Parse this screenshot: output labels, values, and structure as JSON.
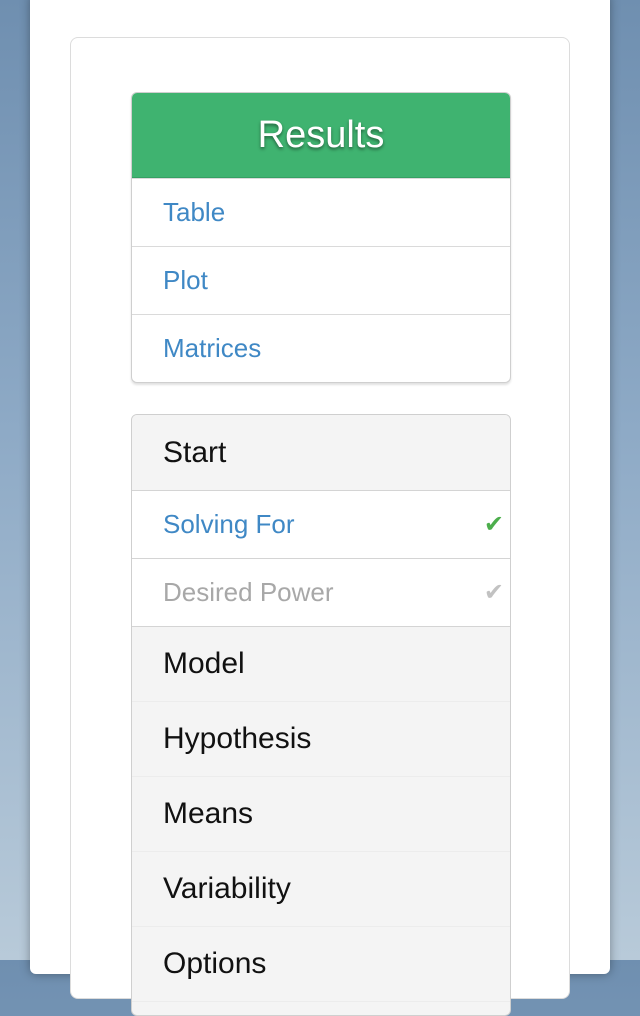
{
  "results": {
    "title": "Results",
    "links": [
      {
        "label": "Table"
      },
      {
        "label": "Plot"
      },
      {
        "label": "Matrices"
      }
    ]
  },
  "steps": {
    "start": {
      "label": "Start",
      "items": [
        {
          "label": "Solving For",
          "status": "complete",
          "icon": "check-icon",
          "color": "#4cae4c"
        },
        {
          "label": "Desired Power",
          "status": "disabled",
          "icon": "check-icon",
          "color": "#c2c2c2"
        }
      ]
    },
    "sections": [
      {
        "label": "Model"
      },
      {
        "label": "Hypothesis"
      },
      {
        "label": "Means"
      },
      {
        "label": "Variability"
      },
      {
        "label": "Options"
      }
    ]
  },
  "colors": {
    "accent": "#3fb370",
    "link": "#3f88c5",
    "check_active": "#4cae4c",
    "check_inactive": "#c2c2c2"
  }
}
